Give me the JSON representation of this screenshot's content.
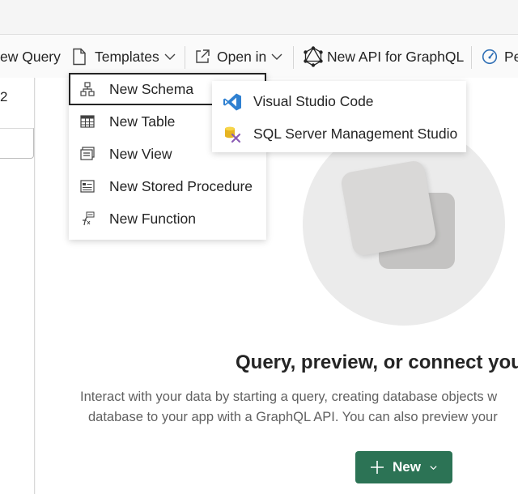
{
  "toolbar": {
    "new_query": "ew Query",
    "templates": "Templates",
    "open_in": "Open in",
    "new_api": "New API for GraphQL",
    "performance": "Pe"
  },
  "left_panel": {
    "number": "2"
  },
  "templates_menu": {
    "items": [
      {
        "label": "New Schema",
        "icon": "schema-icon"
      },
      {
        "label": "New Table",
        "icon": "table-icon"
      },
      {
        "label": "New View",
        "icon": "view-icon"
      },
      {
        "label": "New Stored Procedure",
        "icon": "stored-procedure-icon"
      },
      {
        "label": "New Function",
        "icon": "function-icon"
      }
    ]
  },
  "open_in_menu": {
    "items": [
      {
        "label": "Visual Studio Code",
        "icon": "vscode-icon"
      },
      {
        "label": "SQL Server Management Studio",
        "icon": "ssms-icon"
      }
    ]
  },
  "main": {
    "heading": "Query, preview, or connect you",
    "description_line1": "Interact with your data by starting a query, creating database objects w",
    "description_line2": "database to your app with a GraphQL API. You can also preview your",
    "new_button": "New"
  },
  "colors": {
    "primary_button": "#2c7355",
    "vscode_blue": "#2f80d1"
  }
}
